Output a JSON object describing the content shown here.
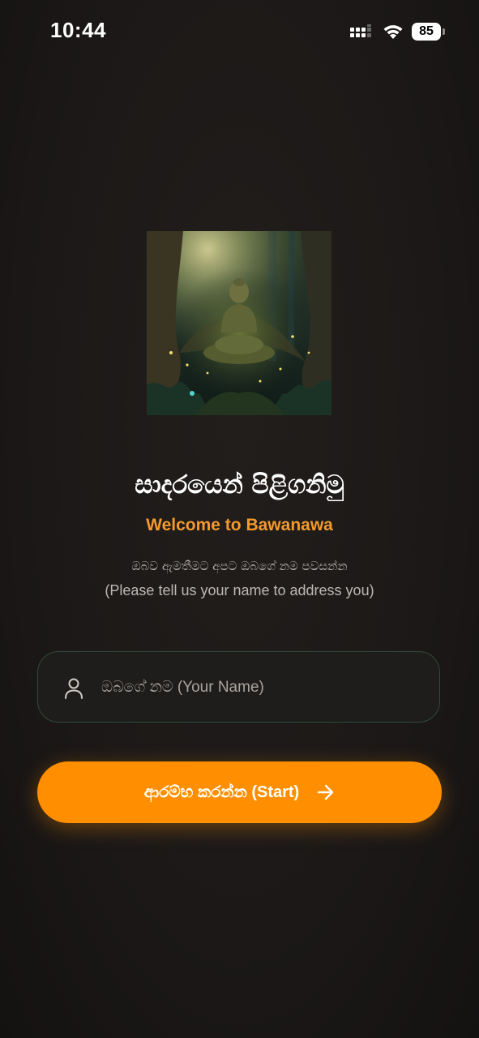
{
  "status_bar": {
    "time": "10:44",
    "battery_level": "85",
    "icons": [
      "signal-icon",
      "wifi-icon",
      "battery-icon"
    ]
  },
  "hero": {
    "image": "meditating-buddha-forest-image"
  },
  "welcome": {
    "title_si": "සාදරයෙන් පිළිගනිමු",
    "title_en": "Welcome to Bawanawa",
    "prompt_si": "ඔබව ඇමතීමට අපට ඔබගේ නම පවසන්න",
    "prompt_en": "(Please tell us your name to address you)"
  },
  "name_input": {
    "placeholder": "ඔබගේ නම (Your Name)",
    "value": "",
    "icon": "person-icon"
  },
  "start_button": {
    "label": "ආරම්භ කරන්න (Start)",
    "icon": "arrow-right-icon"
  },
  "colors": {
    "background": "#1b1817",
    "accent": "#ff8f00",
    "accent_text": "#f49a2c",
    "input_border": "#2f4a3a"
  }
}
